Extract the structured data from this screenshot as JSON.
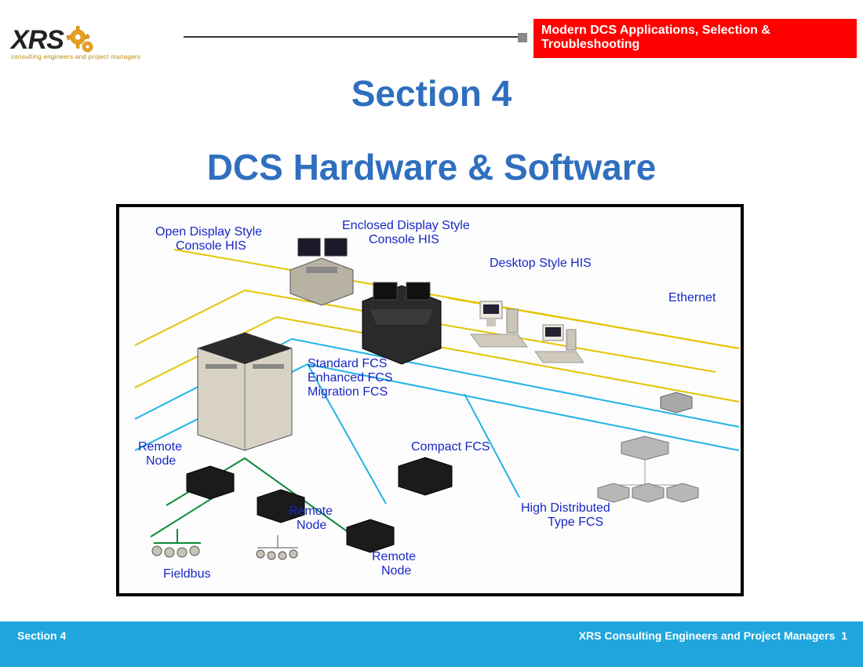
{
  "logo": {
    "text": "XRS",
    "tagline": "consulting engineers and project managers"
  },
  "header": {
    "banner": "Modern DCS Applications, Selection & Troubleshooting"
  },
  "titles": {
    "section_num": "Section 4",
    "section_title": "DCS Hardware & Software"
  },
  "diagram": {
    "labels": {
      "open_console": "Open Display Style\nConsole HIS",
      "enclosed_console": "Enclosed Display Style\nConsole HIS",
      "desktop_his": "Desktop Style HIS",
      "ethernet": "Ethernet",
      "std_fcs": "Standard FCS\nEnhanced FCS\nMigration FCS",
      "remote_node1": "Remote\nNode",
      "remote_node2": "Remote\nNode",
      "remote_node3": "Remote\nNode",
      "compact_fcs": "Compact FCS",
      "hi_dist_fcs": "High Distributed\nType FCS",
      "fieldbus": "Fieldbus"
    }
  },
  "footer": {
    "left": "Section 4",
    "right": "XRS Consulting Engineers and Project Managers",
    "page": "1"
  }
}
